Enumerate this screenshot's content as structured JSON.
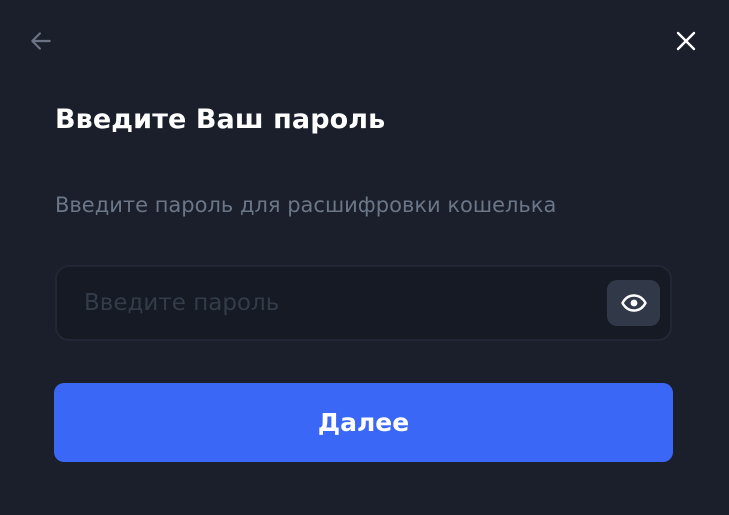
{
  "header": {
    "back_icon": "arrow-left-icon",
    "close_icon": "close-icon"
  },
  "title": "Введите Ваш пароль",
  "subtitle": "Введите пароль для расшифровки кошелька",
  "password_field": {
    "value": "",
    "placeholder": "Введите пароль",
    "toggle_icon": "eye-icon"
  },
  "next_button": {
    "label": "Далее"
  },
  "colors": {
    "background": "#1a1f2b",
    "accent": "#3b67f7",
    "subtitle": "#6b7687",
    "input_bg": "#151a24",
    "eye_button_bg": "#313949"
  }
}
